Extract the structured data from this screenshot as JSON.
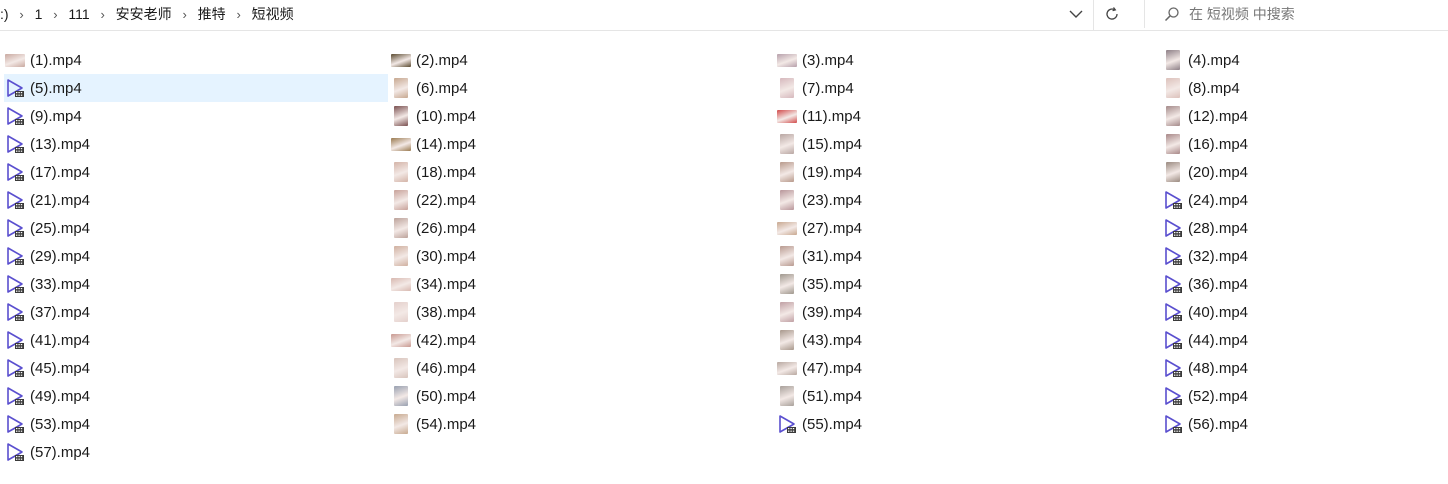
{
  "breadcrumb": {
    "items": [
      ":)",
      "1",
      "111",
      "安安老师",
      "推特",
      "短视频"
    ]
  },
  "search": {
    "placeholder": "在 短视频 中搜索"
  },
  "colors": {
    "selected_bg": "#e5f3ff",
    "play_icon": "#5a4fcf"
  },
  "files": [
    {
      "name": "(1).mp4",
      "icon": "thumb-h",
      "color": "#c9a9a0"
    },
    {
      "name": "(2).mp4",
      "icon": "thumb-h",
      "color": "#5a4a30"
    },
    {
      "name": "(3).mp4",
      "icon": "thumb-h",
      "color": "#b7a0ab"
    },
    {
      "name": "(4).mp4",
      "icon": "thumb-v",
      "color": "#8d7f86"
    },
    {
      "name": "(5).mp4",
      "icon": "play-icon",
      "selected": true
    },
    {
      "name": "(6).mp4",
      "icon": "thumb-v",
      "color": "#c7a890"
    },
    {
      "name": "(7).mp4",
      "icon": "thumb-v",
      "color": "#d6b8bd"
    },
    {
      "name": "(8).mp4",
      "icon": "thumb-v",
      "color": "#dcc1bb"
    },
    {
      "name": "(9).mp4",
      "icon": "play-icon"
    },
    {
      "name": "(10).mp4",
      "icon": "thumb-v",
      "color": "#7a5050"
    },
    {
      "name": "(11).mp4",
      "icon": "thumb-h",
      "color": "#d24b4b"
    },
    {
      "name": "(12).mp4",
      "icon": "thumb-v",
      "color": "#a48a8a"
    },
    {
      "name": "(13).mp4",
      "icon": "play-icon"
    },
    {
      "name": "(14).mp4",
      "icon": "thumb-h",
      "color": "#9a7a50"
    },
    {
      "name": "(15).mp4",
      "icon": "thumb-v",
      "color": "#b9a7a3"
    },
    {
      "name": "(16).mp4",
      "icon": "thumb-v",
      "color": "#a88888"
    },
    {
      "name": "(17).mp4",
      "icon": "play-icon"
    },
    {
      "name": "(18).mp4",
      "icon": "thumb-v",
      "color": "#d4b4a8"
    },
    {
      "name": "(19).mp4",
      "icon": "thumb-v",
      "color": "#b89a8c"
    },
    {
      "name": "(20).mp4",
      "icon": "thumb-v",
      "color": "#9a8a80"
    },
    {
      "name": "(21).mp4",
      "icon": "play-icon"
    },
    {
      "name": "(22).mp4",
      "icon": "thumb-v",
      "color": "#c8a29a"
    },
    {
      "name": "(23).mp4",
      "icon": "thumb-v",
      "color": "#b8969a"
    },
    {
      "name": "(24).mp4",
      "icon": "play-icon"
    },
    {
      "name": "(25).mp4",
      "icon": "play-icon"
    },
    {
      "name": "(26).mp4",
      "icon": "thumb-v",
      "color": "#bca29a"
    },
    {
      "name": "(27).mp4",
      "icon": "thumb-h",
      "color": "#c8a890"
    },
    {
      "name": "(28).mp4",
      "icon": "play-icon"
    },
    {
      "name": "(29).mp4",
      "icon": "play-icon"
    },
    {
      "name": "(30).mp4",
      "icon": "thumb-v",
      "color": "#d0b0a0"
    },
    {
      "name": "(31).mp4",
      "icon": "thumb-v",
      "color": "#b89a90"
    },
    {
      "name": "(32).mp4",
      "icon": "play-icon"
    },
    {
      "name": "(33).mp4",
      "icon": "play-icon"
    },
    {
      "name": "(34).mp4",
      "icon": "thumb-h",
      "color": "#d8b8b0"
    },
    {
      "name": "(35).mp4",
      "icon": "thumb-v",
      "color": "#a0988e"
    },
    {
      "name": "(36).mp4",
      "icon": "play-icon"
    },
    {
      "name": "(37).mp4",
      "icon": "play-icon"
    },
    {
      "name": "(38).mp4",
      "icon": "thumb-v",
      "color": "#e4d0cc"
    },
    {
      "name": "(39).mp4",
      "icon": "thumb-v",
      "color": "#c0a0a4"
    },
    {
      "name": "(40).mp4",
      "icon": "play-icon"
    },
    {
      "name": "(41).mp4",
      "icon": "play-icon"
    },
    {
      "name": "(42).mp4",
      "icon": "thumb-h",
      "color": "#c89890"
    },
    {
      "name": "(43).mp4",
      "icon": "thumb-v",
      "color": "#a8988c"
    },
    {
      "name": "(44).mp4",
      "icon": "play-icon"
    },
    {
      "name": "(45).mp4",
      "icon": "play-icon"
    },
    {
      "name": "(46).mp4",
      "icon": "thumb-v",
      "color": "#d8c4bc"
    },
    {
      "name": "(47).mp4",
      "icon": "thumb-h",
      "color": "#b8a8a0"
    },
    {
      "name": "(48).mp4",
      "icon": "play-icon"
    },
    {
      "name": "(49).mp4",
      "icon": "play-icon"
    },
    {
      "name": "(50).mp4",
      "icon": "thumb-v",
      "color": "#98a0b0"
    },
    {
      "name": "(51).mp4",
      "icon": "thumb-v",
      "color": "#a8a09a"
    },
    {
      "name": "(52).mp4",
      "icon": "play-icon"
    },
    {
      "name": "(53).mp4",
      "icon": "play-icon"
    },
    {
      "name": "(54).mp4",
      "icon": "thumb-v",
      "color": "#c8aa90"
    },
    {
      "name": "(55).mp4",
      "icon": "play-icon"
    },
    {
      "name": "(56).mp4",
      "icon": "play-icon"
    },
    {
      "name": "(57).mp4",
      "icon": "play-icon"
    }
  ]
}
